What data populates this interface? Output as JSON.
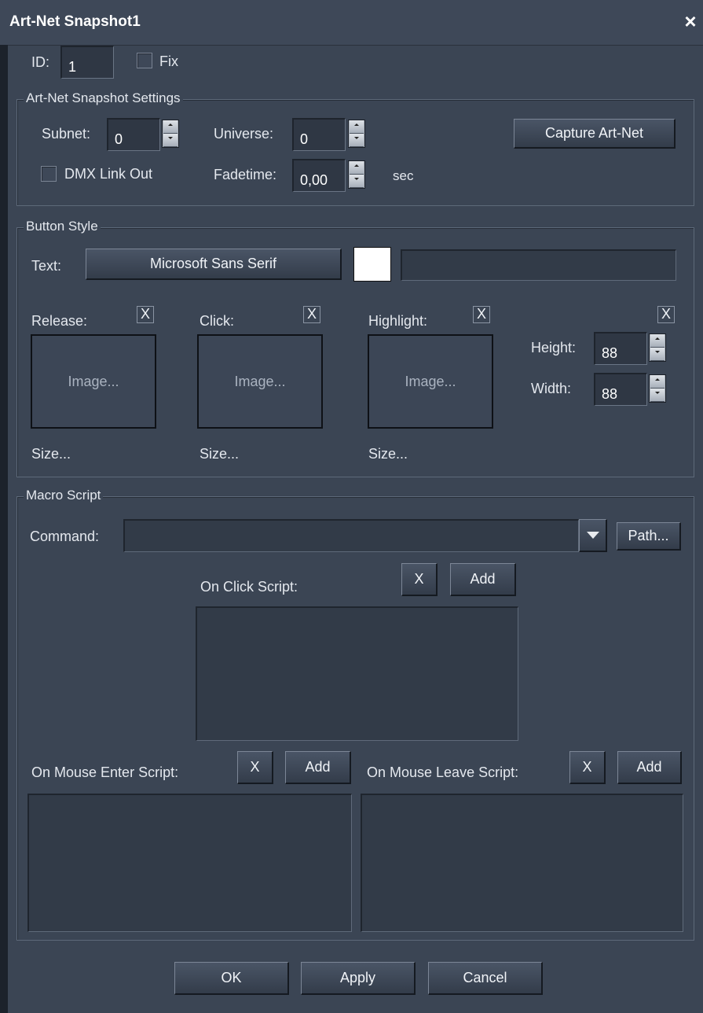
{
  "window": {
    "title": "Art-Net Snapshot1",
    "close_glyph": "×"
  },
  "id_row": {
    "id_label": "ID:",
    "id_value": "1",
    "fix_label": "Fix"
  },
  "snapshot_settings": {
    "legend": "Art-Net Snapshot Settings",
    "subnet_label": "Subnet:",
    "subnet_value": "0",
    "universe_label": "Universe:",
    "universe_value": "0",
    "capture_button": "Capture Art-Net",
    "dmx_link_out_label": "DMX Link Out",
    "fadetime_label": "Fadetime:",
    "fadetime_value": "0,00",
    "fadetime_unit": "sec"
  },
  "button_style": {
    "legend": "Button Style",
    "text_label": "Text:",
    "font_button": "Microsoft Sans Serif",
    "text_color": "#ffffff",
    "release_label": "Release:",
    "click_label": "Click:",
    "highlight_label": "Highlight:",
    "clear_glyph": "X",
    "image_placeholder": "Image...",
    "size_link": "Size...",
    "height_label": "Height:",
    "height_value": "88",
    "width_label": "Width:",
    "width_value": "88"
  },
  "macro_script": {
    "legend": "Macro Script",
    "command_label": "Command:",
    "command_value": "",
    "path_button": "Path...",
    "on_click_label": "On Click Script:",
    "on_mouse_enter_label": "On Mouse Enter Script:",
    "on_mouse_leave_label": "On Mouse Leave Script:",
    "clear_glyph": "X",
    "add_button": "Add"
  },
  "footer": {
    "ok": "OK",
    "apply": "Apply",
    "cancel": "Cancel"
  }
}
